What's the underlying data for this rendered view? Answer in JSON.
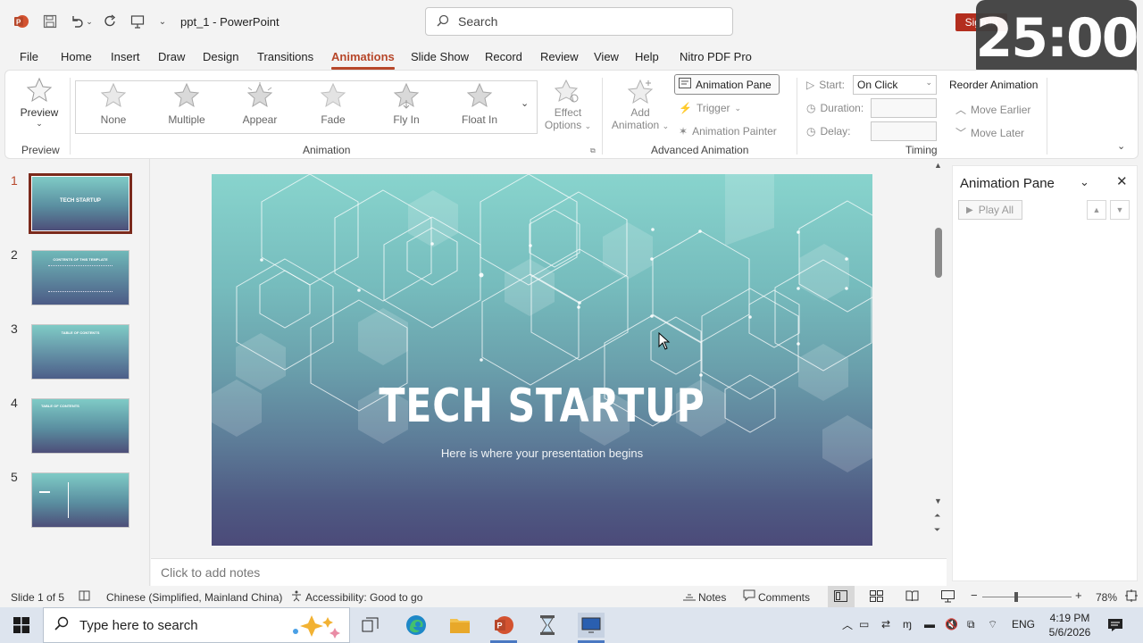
{
  "window": {
    "title": "ppt_1  -  PowerPoint",
    "signin_label": "Sign in"
  },
  "search": {
    "placeholder": "Search"
  },
  "timer": {
    "value": "25:00"
  },
  "menu_tabs": [
    "File",
    "Home",
    "Insert",
    "Draw",
    "Design",
    "Transitions",
    "Animations",
    "Slide Show",
    "Record",
    "Review",
    "View",
    "Help",
    "Nitro PDF Pro"
  ],
  "active_tab": "Animations",
  "ribbon": {
    "preview_label": "Preview",
    "preview_group": "Preview",
    "animations": [
      "None",
      "Multiple",
      "Appear",
      "Fade",
      "Fly In",
      "Float In"
    ],
    "effect_options_1": "Effect",
    "effect_options_2": "Options",
    "animation_group": "Animation",
    "add_animation_1": "Add",
    "add_animation_2": "Animation",
    "animation_pane_btn": "Animation Pane",
    "trigger": "Trigger",
    "animation_painter": "Animation Painter",
    "advanced_group": "Advanced Animation",
    "start_label": "Start:",
    "start_value": "On Click",
    "duration_label": "Duration:",
    "delay_label": "Delay:",
    "timing_group": "Timing",
    "reorder_label": "Reorder Animation",
    "move_earlier": "Move Earlier",
    "move_later": "Move Later"
  },
  "slides": [
    {
      "num": "1",
      "caption": "TECH STARTUP"
    },
    {
      "num": "2",
      "caption": "CONTENTS OF THIS TEMPLATE"
    },
    {
      "num": "3",
      "caption": "TABLE OF CONTENTS"
    },
    {
      "num": "4",
      "caption": "TABLE OF CONTENTS"
    },
    {
      "num": "5",
      "caption": ""
    }
  ],
  "slide": {
    "title": "TECH STARTUP",
    "subtitle": "Here is where your presentation begins"
  },
  "notes": {
    "placeholder": "Click to add notes"
  },
  "animation_pane": {
    "title": "Animation Pane",
    "play_all": "Play All"
  },
  "status": {
    "slide_of": "Slide 1 of 5",
    "language": "Chinese (Simplified, Mainland China)",
    "accessibility": "Accessibility: Good to go",
    "notes": "Notes",
    "comments": "Comments",
    "zoom": "78%"
  },
  "taskbar": {
    "search_placeholder": "Type here to search",
    "lang": "ENG",
    "time": "4:19 PM",
    "date": "5/6/2026"
  }
}
